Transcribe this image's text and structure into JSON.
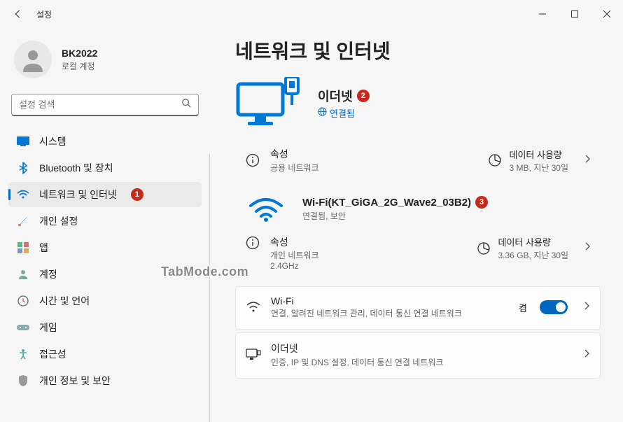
{
  "window": {
    "title": "설정"
  },
  "user": {
    "name": "BK2022",
    "account_type": "로컬 계정"
  },
  "search": {
    "placeholder": "설정 검색"
  },
  "nav": {
    "items": [
      {
        "label": "시스템",
        "icon": "system"
      },
      {
        "label": "Bluetooth 및 장치",
        "icon": "bluetooth"
      },
      {
        "label": "네트워크 및 인터넷",
        "icon": "wifi",
        "badge": "1"
      },
      {
        "label": "개인 설정",
        "icon": "brush"
      },
      {
        "label": "앱",
        "icon": "apps"
      },
      {
        "label": "계정",
        "icon": "account"
      },
      {
        "label": "시간 및 언어",
        "icon": "time"
      },
      {
        "label": "게임",
        "icon": "game"
      },
      {
        "label": "접근성",
        "icon": "access"
      },
      {
        "label": "개인 정보 및 보안",
        "icon": "shield"
      }
    ]
  },
  "page": {
    "title": "네트워크 및 인터넷"
  },
  "ethernet_hero": {
    "title": "이더넷",
    "badge": "2",
    "status": "연결됨"
  },
  "eth_props": {
    "title": "속성",
    "sub": "공용 네트워크",
    "data_title": "데이터 사용량",
    "data_sub": "3 MB, 지난 30일"
  },
  "wifi_hero": {
    "title": "Wi-Fi(KT_GiGA_2G_Wave2_03B2)",
    "badge": "3",
    "status": "연결됨, 보안"
  },
  "wifi_props": {
    "title": "속성",
    "sub": "개인 네트워크",
    "sub2": "2.4GHz",
    "data_title": "데이터 사용량",
    "data_sub": "3.36 GB, 지난 30일"
  },
  "wifi_setting": {
    "title": "Wi-Fi",
    "sub": "연결, 알려진 네트워크 관리, 데이터 통신 연결 네트워크",
    "toggle_label": "켬"
  },
  "eth_setting": {
    "title": "이더넷",
    "sub": "인증, IP 및 DNS 설정, 데이터 통신 연결 네트워크"
  },
  "watermark": "TabMode.com"
}
